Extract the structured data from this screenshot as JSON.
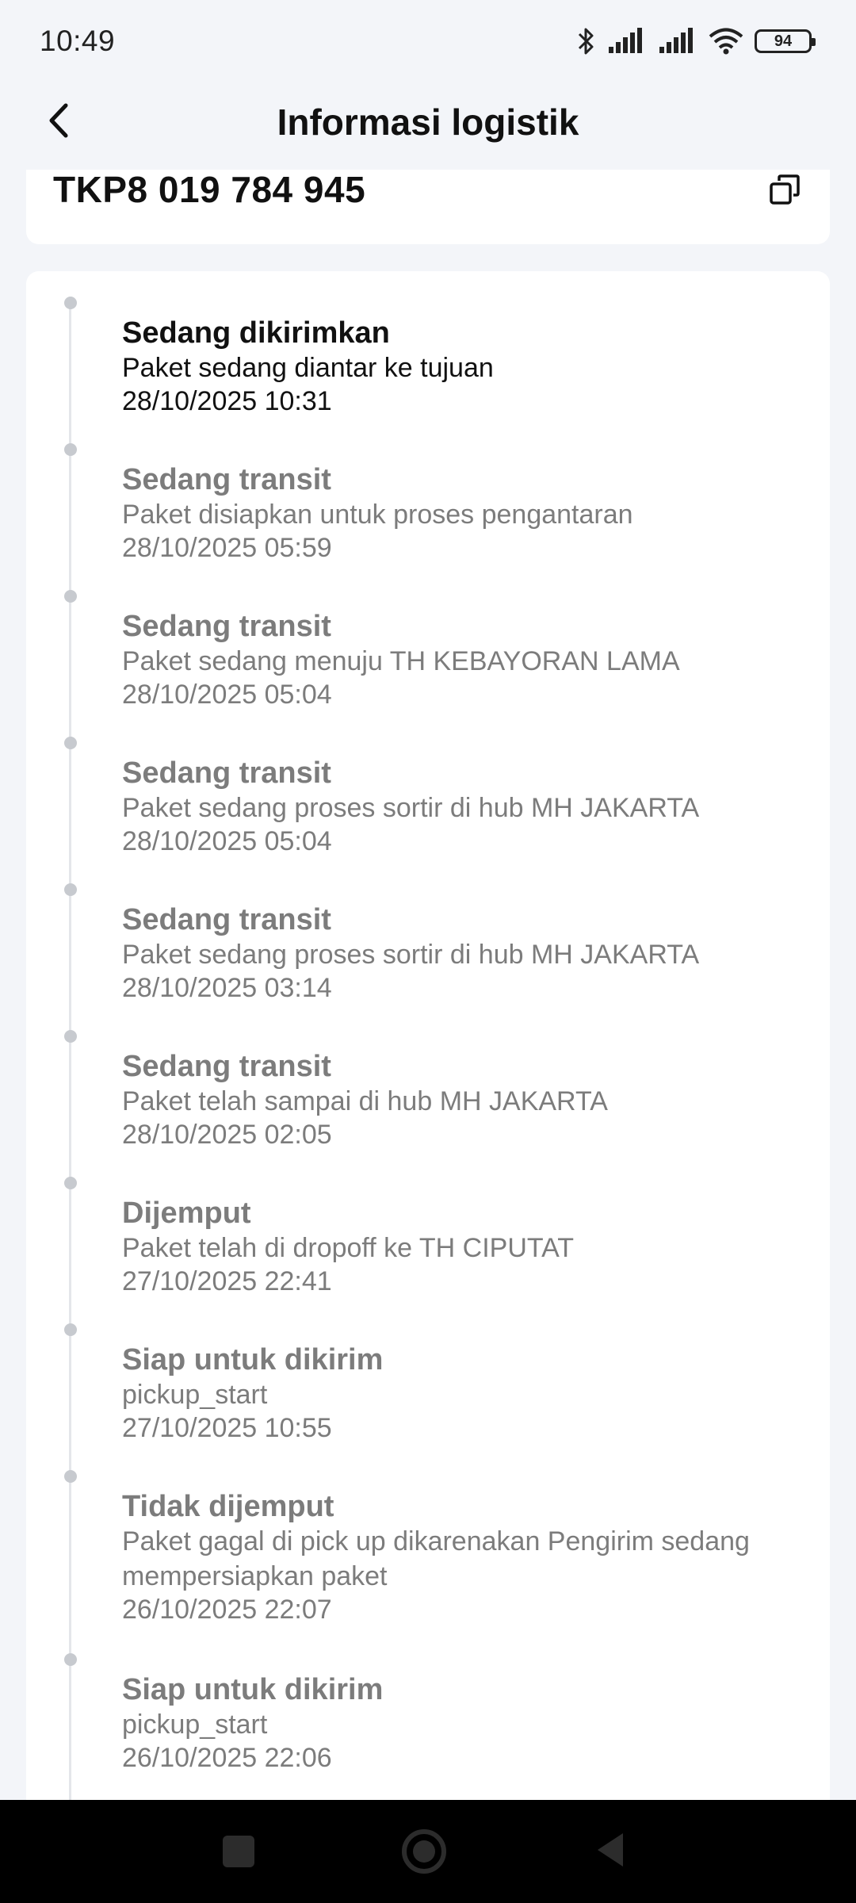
{
  "status_bar": {
    "time": "10:49",
    "battery": "94",
    "icons": [
      "bluetooth-icon",
      "signal-icon",
      "signal-icon",
      "wifi-icon",
      "battery-icon"
    ]
  },
  "header": {
    "title": "Informasi logistik",
    "back_icon": "chevron-left-icon"
  },
  "tracking": {
    "number": "TKP8 019 784 945",
    "copy_icon": "copy-icon"
  },
  "colors": {
    "active_text": "#111111",
    "inactive_text": "#7c7c7c",
    "dot": "#c7cacf",
    "background": "#f3f5f9"
  },
  "events": [
    {
      "status": "Sedang dikirimkan",
      "description": "Paket sedang diantar ke tujuan",
      "time": "28/10/2025 10:31",
      "active": true
    },
    {
      "status": "Sedang transit",
      "description": "Paket disiapkan untuk proses pengantaran",
      "time": "28/10/2025 05:59"
    },
    {
      "status": "Sedang transit",
      "description": "Paket sedang menuju TH KEBAYORAN LAMA",
      "time": "28/10/2025 05:04"
    },
    {
      "status": "Sedang transit",
      "description": "Paket sedang proses sortir di hub MH JAKARTA",
      "time": "28/10/2025 05:04"
    },
    {
      "status": "Sedang transit",
      "description": "Paket sedang proses sortir di hub MH JAKARTA",
      "time": "28/10/2025 03:14"
    },
    {
      "status": "Sedang transit",
      "description": "Paket telah sampai di hub MH JAKARTA",
      "time": "28/10/2025 02:05"
    },
    {
      "status": "Dijemput",
      "description": "Paket telah di dropoff ke TH CIPUTAT",
      "time": "27/10/2025 22:41"
    },
    {
      "status": "Siap untuk dikirim",
      "description": "pickup_start",
      "time": "27/10/2025 10:55"
    },
    {
      "status": "Tidak dijemput",
      "description": "Paket gagal di pick up dikarenakan Pengirim sedang mempersiapkan paket",
      "time": "26/10/2025 22:07"
    },
    {
      "status": "Siap untuk dikirim",
      "description": "pickup_start",
      "time": "26/10/2025 22:06"
    }
  ],
  "nav_bar": {
    "icons": [
      "recent-apps-icon",
      "home-icon",
      "back-triangle-icon"
    ]
  }
}
